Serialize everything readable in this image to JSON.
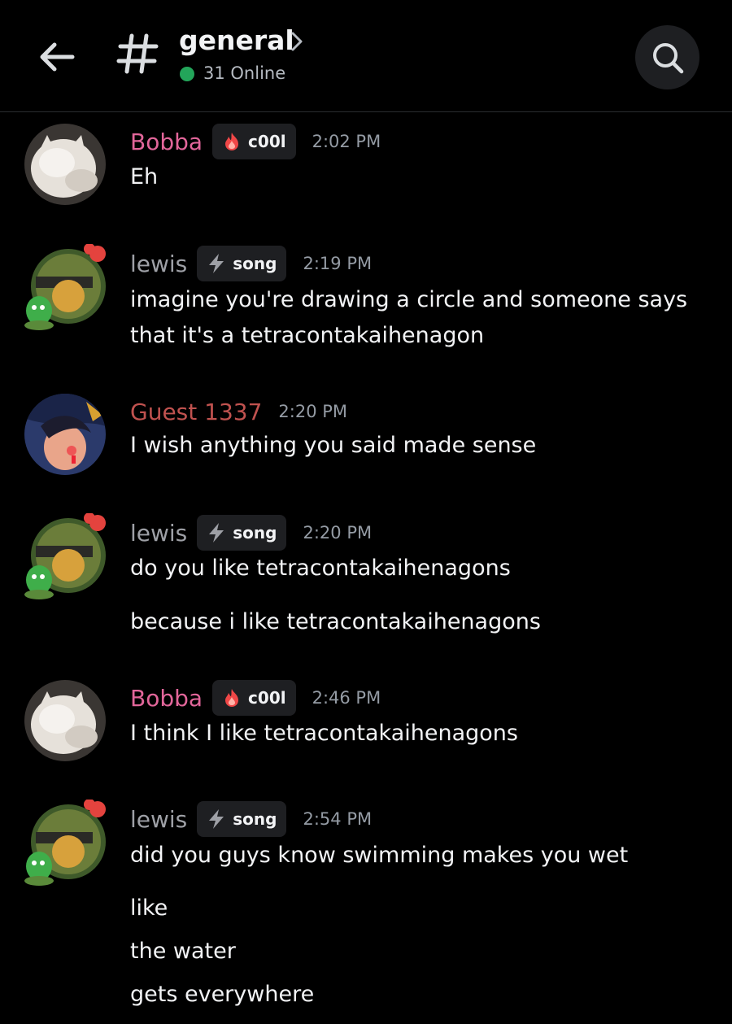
{
  "header": {
    "channel_name": "general",
    "online_text": "31 Online",
    "back_icon": "arrow-left-icon",
    "hash_icon": "hash-icon",
    "search_icon": "search-icon"
  },
  "colors": {
    "bobba": "#e2669a",
    "lewis": "#9ea0a6",
    "guest": "#c0524f",
    "online": "#23a55a"
  },
  "messages": [
    {
      "username": "Bobba",
      "tag": "c00l",
      "time": "2:02 PM",
      "lines": [
        "Eh"
      ]
    },
    {
      "username": "lewis",
      "tag": "song",
      "time": "2:19 PM",
      "lines": [
        "imagine you're drawing a circle and someone says",
        "that it's a tetracontakaihenagon"
      ]
    },
    {
      "username": "Guest 1337",
      "time": "2:20 PM",
      "lines": [
        "I wish anything you said made sense"
      ]
    },
    {
      "username": "lewis",
      "tag": "song",
      "time": "2:20 PM",
      "lines": [
        "do you like tetracontakaihenagons",
        "because i like tetracontakaihenagons"
      ]
    },
    {
      "username": "Bobba",
      "tag": "c00l",
      "time": "2:46 PM",
      "lines": [
        "I think I like tetracontakaihenagons"
      ]
    },
    {
      "username": "lewis",
      "tag": "song",
      "time": "2:54 PM",
      "lines": [
        "did you guys know swimming makes you wet",
        "like",
        "the water",
        "gets everywhere"
      ]
    }
  ]
}
